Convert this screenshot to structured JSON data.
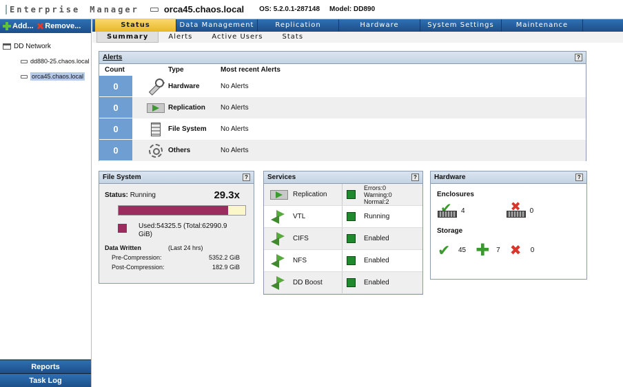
{
  "header": {
    "brand_word1": "Enterprise",
    "brand_word2": "Manager",
    "hostname": "orca45.chaos.local",
    "os": "OS: 5.2.0.1-287148",
    "model": "Model: DD890"
  },
  "sidebar": {
    "add_label": "Add...",
    "remove_label": "Remove...",
    "root_label": "DD Network",
    "systems": [
      "dd880-25.chaos.local",
      "orca45.chaos.local"
    ],
    "selected_system": "orca45.chaos.local",
    "reports_label": "Reports",
    "tasklog_label": "Task Log"
  },
  "tabs": [
    "Status",
    "Data Management",
    "Replication",
    "Hardware",
    "System Settings",
    "Maintenance"
  ],
  "active_tab": "Status",
  "subtabs": [
    "Summary",
    "Alerts",
    "Active Users",
    "Stats"
  ],
  "active_subtab": "Summary",
  "help_label": "?",
  "alerts_panel": {
    "title": "Alerts",
    "columns": [
      "Count",
      "Type",
      "Most recent Alerts"
    ],
    "rows": [
      {
        "count": "0",
        "type": "Hardware",
        "message": "No Alerts",
        "icon": "wrench-icon"
      },
      {
        "count": "0",
        "type": "Replication",
        "message": "No Alerts",
        "icon": "replication-icon"
      },
      {
        "count": "0",
        "type": "File System",
        "message": "No Alerts",
        "icon": "file-system-icon"
      },
      {
        "count": "0",
        "type": "Others",
        "message": "No Alerts",
        "icon": "gear-icon"
      }
    ]
  },
  "filesystem_panel": {
    "title": "File System",
    "status_label": "Status:",
    "status_value": "Running",
    "compression_ratio": "29.3x",
    "used_fraction": 0.8635,
    "used_text": "Used:54325.5 (Total:62990.9 GiB)",
    "data_written_label": "Data Written",
    "data_written_period": "(Last 24 hrs)",
    "pre_compression_label": "Pre-Compression:",
    "pre_compression_value": "5352.2 GiB",
    "post_compression_label": "Post-Compression:",
    "post_compression_value": "182.9 GiB",
    "colors": {
      "used": "#9b2d5e",
      "free": "#fcf7c8"
    }
  },
  "services_panel": {
    "title": "Services",
    "rows": [
      {
        "name": "Replication",
        "status": "Errors:0 Warning:0 Normal:2",
        "icon": "replication-icon"
      },
      {
        "name": "VTL",
        "status": "Running",
        "icon": "arrows-icon"
      },
      {
        "name": "CIFS",
        "status": "Enabled",
        "icon": "arrows-icon"
      },
      {
        "name": "NFS",
        "status": "Enabled",
        "icon": "arrows-icon"
      },
      {
        "name": "DD Boost",
        "status": "Enabled",
        "icon": "arrows-icon"
      }
    ],
    "status_color": "#1f8a2d"
  },
  "hardware_panel": {
    "title": "Hardware",
    "enclosures_label": "Enclosures",
    "enclosures_ok": "4",
    "enclosures_failed": "0",
    "storage_label": "Storage",
    "storage_in_use": "45",
    "storage_spare": "7",
    "storage_failed": "0"
  }
}
